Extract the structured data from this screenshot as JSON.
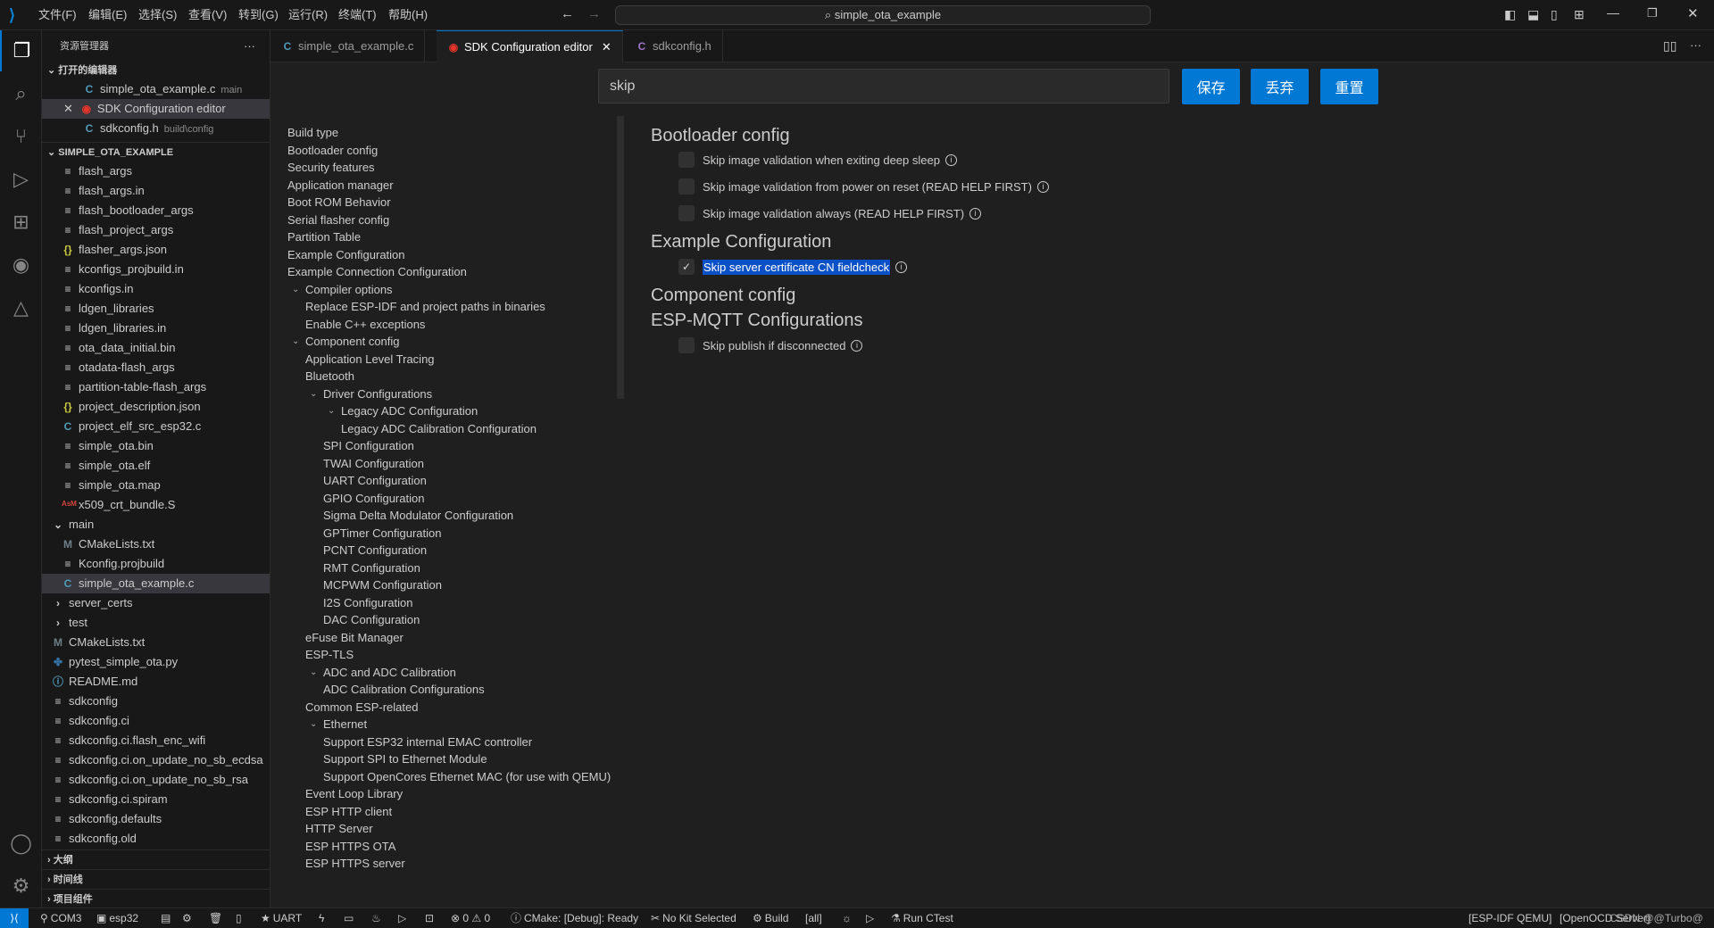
{
  "titlebar": {
    "menus": [
      "文件(F)",
      "编辑(E)",
      "选择(S)",
      "查看(V)",
      "转到(G)",
      "运行(R)",
      "终端(T)",
      "帮助(H)"
    ],
    "search": "simple_ota_example"
  },
  "sidebar": {
    "title": "资源管理器",
    "open_editors_label": "打开的编辑器",
    "open_editors": [
      {
        "name": "simple_ota_example.c",
        "desc": "main",
        "icon": "c"
      },
      {
        "name": "SDK Configuration editor",
        "desc": "",
        "icon": "espressif"
      },
      {
        "name": "sdkconfig.h",
        "desc": "build\\config",
        "icon": "c"
      }
    ],
    "project_label": "SIMPLE_OTA_EXAMPLE",
    "files": [
      {
        "name": "flash_args",
        "icon": "file",
        "indent": 2
      },
      {
        "name": "flash_args.in",
        "icon": "file",
        "indent": 2
      },
      {
        "name": "flash_bootloader_args",
        "icon": "file",
        "indent": 2
      },
      {
        "name": "flash_project_args",
        "icon": "file",
        "indent": 2
      },
      {
        "name": "flasher_args.json",
        "icon": "json",
        "indent": 2
      },
      {
        "name": "kconfigs_projbuild.in",
        "icon": "file",
        "indent": 2
      },
      {
        "name": "kconfigs.in",
        "icon": "file",
        "indent": 2
      },
      {
        "name": "ldgen_libraries",
        "icon": "file",
        "indent": 2
      },
      {
        "name": "ldgen_libraries.in",
        "icon": "file",
        "indent": 2
      },
      {
        "name": "ota_data_initial.bin",
        "icon": "file",
        "indent": 2
      },
      {
        "name": "otadata-flash_args",
        "icon": "file",
        "indent": 2
      },
      {
        "name": "partition-table-flash_args",
        "icon": "file",
        "indent": 2
      },
      {
        "name": "project_description.json",
        "icon": "json",
        "indent": 2
      },
      {
        "name": "project_elf_src_esp32.c",
        "icon": "c",
        "indent": 2
      },
      {
        "name": "simple_ota.bin",
        "icon": "file",
        "indent": 2
      },
      {
        "name": "simple_ota.elf",
        "icon": "file",
        "indent": 2
      },
      {
        "name": "simple_ota.map",
        "icon": "file",
        "indent": 2
      },
      {
        "name": "x509_crt_bundle.S",
        "icon": "asm",
        "indent": 2
      },
      {
        "name": "main",
        "icon": "folder-open",
        "indent": 1
      },
      {
        "name": "CMakeLists.txt",
        "icon": "cmake",
        "indent": 2
      },
      {
        "name": "Kconfig.projbuild",
        "icon": "file",
        "indent": 2
      },
      {
        "name": "simple_ota_example.c",
        "icon": "c",
        "indent": 2,
        "selected": true
      },
      {
        "name": "server_certs",
        "icon": "folder",
        "indent": 1
      },
      {
        "name": "test",
        "icon": "folder",
        "indent": 1
      },
      {
        "name": "CMakeLists.txt",
        "icon": "cmake",
        "indent": 1
      },
      {
        "name": "pytest_simple_ota.py",
        "icon": "python",
        "indent": 1
      },
      {
        "name": "README.md",
        "icon": "info",
        "indent": 1
      },
      {
        "name": "sdkconfig",
        "icon": "file",
        "indent": 1
      },
      {
        "name": "sdkconfig.ci",
        "icon": "file",
        "indent": 1
      },
      {
        "name": "sdkconfig.ci.flash_enc_wifi",
        "icon": "file",
        "indent": 1
      },
      {
        "name": "sdkconfig.ci.on_update_no_sb_ecdsa",
        "icon": "file",
        "indent": 1
      },
      {
        "name": "sdkconfig.ci.on_update_no_sb_rsa",
        "icon": "file",
        "indent": 1
      },
      {
        "name": "sdkconfig.ci.spiram",
        "icon": "file",
        "indent": 1
      },
      {
        "name": "sdkconfig.defaults",
        "icon": "file",
        "indent": 1
      },
      {
        "name": "sdkconfig.old",
        "icon": "file",
        "indent": 1
      }
    ],
    "bottom_sections": [
      "大纲",
      "时间线",
      "项目组件"
    ]
  },
  "tabs": [
    {
      "label": "simple_ota_example.c",
      "icon": "c"
    },
    {
      "label": "SDK Configuration editor",
      "icon": "espressif",
      "active": true
    },
    {
      "label": "sdkconfig.h",
      "icon": "c"
    }
  ],
  "editor": {
    "search_value": "skip",
    "buttons": {
      "save": "保存",
      "discard": "丢弃",
      "reset": "重置"
    },
    "nav": [
      {
        "label": "Build type",
        "level": 0
      },
      {
        "label": "Bootloader config",
        "level": 0
      },
      {
        "label": "Security features",
        "level": 0
      },
      {
        "label": "Application manager",
        "level": 0
      },
      {
        "label": "Boot ROM Behavior",
        "level": 0
      },
      {
        "label": "Serial flasher config",
        "level": 0
      },
      {
        "label": "Partition Table",
        "level": 0
      },
      {
        "label": "Example Configuration",
        "level": 0
      },
      {
        "label": "Example Connection Configuration",
        "level": 0
      },
      {
        "label": "Compiler options",
        "level": 0,
        "expanded": true
      },
      {
        "label": "Replace ESP-IDF and project paths in binaries",
        "level": 1
      },
      {
        "label": "Enable C++ exceptions",
        "level": 1
      },
      {
        "label": "Component config",
        "level": 0,
        "expanded": true
      },
      {
        "label": "Application Level Tracing",
        "level": 1
      },
      {
        "label": "Bluetooth",
        "level": 1
      },
      {
        "label": "Driver Configurations",
        "level": 1,
        "expanded": true
      },
      {
        "label": "Legacy ADC Configuration",
        "level": 2,
        "expanded": true
      },
      {
        "label": "Legacy ADC Calibration Configuration",
        "level": 3
      },
      {
        "label": "SPI Configuration",
        "level": 2
      },
      {
        "label": "TWAI Configuration",
        "level": 2
      },
      {
        "label": "UART Configuration",
        "level": 2
      },
      {
        "label": "GPIO Configuration",
        "level": 2
      },
      {
        "label": "Sigma Delta Modulator Configuration",
        "level": 2
      },
      {
        "label": "GPTimer Configuration",
        "level": 2
      },
      {
        "label": "PCNT Configuration",
        "level": 2
      },
      {
        "label": "RMT Configuration",
        "level": 2
      },
      {
        "label": "MCPWM Configuration",
        "level": 2
      },
      {
        "label": "I2S Configuration",
        "level": 2
      },
      {
        "label": "DAC Configuration",
        "level": 2
      },
      {
        "label": "eFuse Bit Manager",
        "level": 1
      },
      {
        "label": "ESP-TLS",
        "level": 1
      },
      {
        "label": "ADC and ADC Calibration",
        "level": 1,
        "expanded": true
      },
      {
        "label": "ADC Calibration Configurations",
        "level": 2
      },
      {
        "label": "Common ESP-related",
        "level": 1
      },
      {
        "label": "Ethernet",
        "level": 1,
        "expanded": true
      },
      {
        "label": "Support ESP32 internal EMAC controller",
        "level": 2
      },
      {
        "label": "Support SPI to Ethernet Module",
        "level": 2
      },
      {
        "label": "Support OpenCores Ethernet MAC (for use with QEMU)",
        "level": 2
      },
      {
        "label": "Event Loop Library",
        "level": 1
      },
      {
        "label": "ESP HTTP client",
        "level": 1
      },
      {
        "label": "HTTP Server",
        "level": 1
      },
      {
        "label": "ESP HTTPS OTA",
        "level": 1
      },
      {
        "label": "ESP HTTPS server",
        "level": 1
      }
    ],
    "content": [
      {
        "type": "heading",
        "text": "Bootloader config"
      },
      {
        "type": "option",
        "text": "Skip image validation when exiting deep sleep",
        "checked": false
      },
      {
        "type": "option",
        "text": "Skip image validation from power on reset (READ HELP FIRST)",
        "checked": false
      },
      {
        "type": "option",
        "text": "Skip image validation always (READ HELP FIRST)",
        "checked": false
      },
      {
        "type": "heading",
        "text": "Example Configuration"
      },
      {
        "type": "option",
        "text": "Skip server certificate CN fieldcheck",
        "checked": true,
        "highlighted": true
      },
      {
        "type": "heading",
        "text": "Component config"
      },
      {
        "type": "heading",
        "text": "ESP-MQTT Configurations"
      },
      {
        "type": "option",
        "text": "Skip publish if disconnected",
        "checked": false
      }
    ]
  },
  "statusbar": {
    "left": [
      "COM3",
      "esp32",
      "UART",
      "⊗ 0 ⚠ 0",
      "CMake: [Debug]: Ready",
      "No Kit Selected",
      "Build",
      "[all]",
      "Run CTest"
    ],
    "right": [
      "[ESP-IDF QEMU]",
      "[OpenOCD Server]"
    ],
    "watermark": "CSDN @@Turbo@"
  },
  "colors": {
    "accent": "#0078d4",
    "selection": "#0a50c6"
  }
}
